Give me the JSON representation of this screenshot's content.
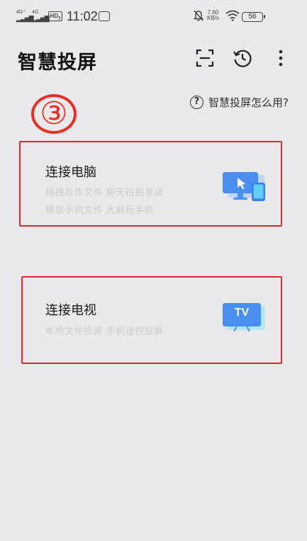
{
  "status_bar": {
    "sim1": "4G⁺",
    "sim2": "4G",
    "hd": "HD",
    "hd_sub": "2",
    "time": "11:02",
    "speed_value": "7.60",
    "speed_unit": "KB/s",
    "battery": "56"
  },
  "header": {
    "title": "智慧投屏"
  },
  "help": {
    "label": "智慧投屏怎么用?"
  },
  "annotation": {
    "step": "③"
  },
  "cards": [
    {
      "title": "连接电脑",
      "lines": [
        "拖拽互传文件 聊天拍拍发送",
        "键鼠手机文件 大屏玩手机"
      ]
    },
    {
      "title": "连接电视",
      "lines": [
        "本地文件投屏 手机遥控投屏"
      ],
      "icon_text": "TV"
    }
  ],
  "colors": {
    "background": "#e9e9eb",
    "highlight_red": "#d9282e",
    "icon_blue": "#4a8ef0",
    "icon_cyan": "#5fd0f5"
  }
}
